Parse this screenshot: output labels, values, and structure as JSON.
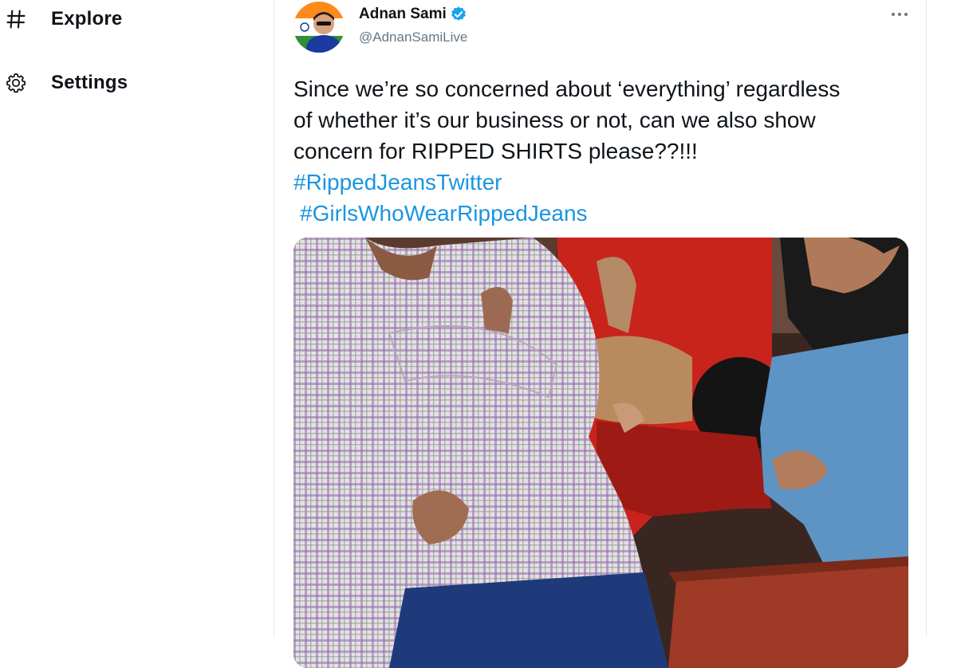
{
  "sidebar": {
    "items": [
      {
        "label": "Explore",
        "icon": "hashtag-icon"
      },
      {
        "label": "Settings",
        "icon": "gear-icon"
      }
    ]
  },
  "tweet": {
    "author": {
      "display_name": "Adnan Sami",
      "handle": "@AdnanSamiLive",
      "verified": true
    },
    "text_lines": [
      "Since we’re so concerned about ‘everything’ regardless",
      "of whether it’s our business or not, can we also show",
      "concern for RIPPED SHIRTS please??!!!"
    ],
    "hashtags": [
      "#RippedJeansTwitter",
      "#GirlsWhoWearRippedJeans"
    ],
    "media": {
      "icon": "tweet-photo"
    }
  },
  "colors": {
    "text": "#0f1419",
    "secondary": "#657786",
    "link": "#1b95e0",
    "verified": "#1da1f2",
    "border": "#e6ecf0"
  }
}
